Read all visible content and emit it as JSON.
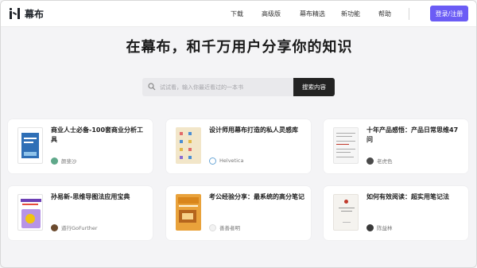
{
  "header": {
    "brand": "幕布",
    "nav": [
      "下载",
      "高级版",
      "幕布精选",
      "新功能",
      "帮助"
    ],
    "login_label": "登录/注册",
    "accent_color": "#6b5cf5"
  },
  "hero": {
    "headline": "在幕布，和千万用户分享你的知识",
    "search_placeholder": "试试看，输入你最近看过的一本书",
    "search_button": "搜索内容"
  },
  "cards": [
    {
      "title": "商业人士必备-100套商业分析工具",
      "author": "颜斐沙",
      "cover_color": "#4a90d9",
      "cover_icon": "book-cover-blue",
      "avatar_color": "#5fa88a"
    },
    {
      "title": "设计师用幕布打造的私人灵感库",
      "author": "Helvetica",
      "cover_color": "#f2e6c9",
      "cover_icon": "book-cover-cream",
      "avatar_color": "#6aa6d6"
    },
    {
      "title": "十年产品感悟：产品日常思维47问",
      "author": "老虎色",
      "cover_color": "#f3f3f3",
      "cover_icon": "book-cover-white",
      "avatar_color": "#4a4a4a"
    },
    {
      "title": "孙易新-思维导图法应用宝典",
      "author": "道行GoFurther",
      "cover_color": "#8f5cc9",
      "cover_icon": "book-cover-purple",
      "avatar_color": "#6b4a2e"
    },
    {
      "title": "考公经验分享：最系统的高分笔记",
      "author": "善善者明",
      "cover_color": "#e9a23b",
      "cover_icon": "book-cover-orange",
      "avatar_color": "#dcdcdc"
    },
    {
      "title": "如何有效阅读：超实用笔记法",
      "author": "陈益林",
      "cover_color": "#f5f3ef",
      "cover_icon": "book-cover-light",
      "avatar_color": "#3a3a3a"
    }
  ]
}
